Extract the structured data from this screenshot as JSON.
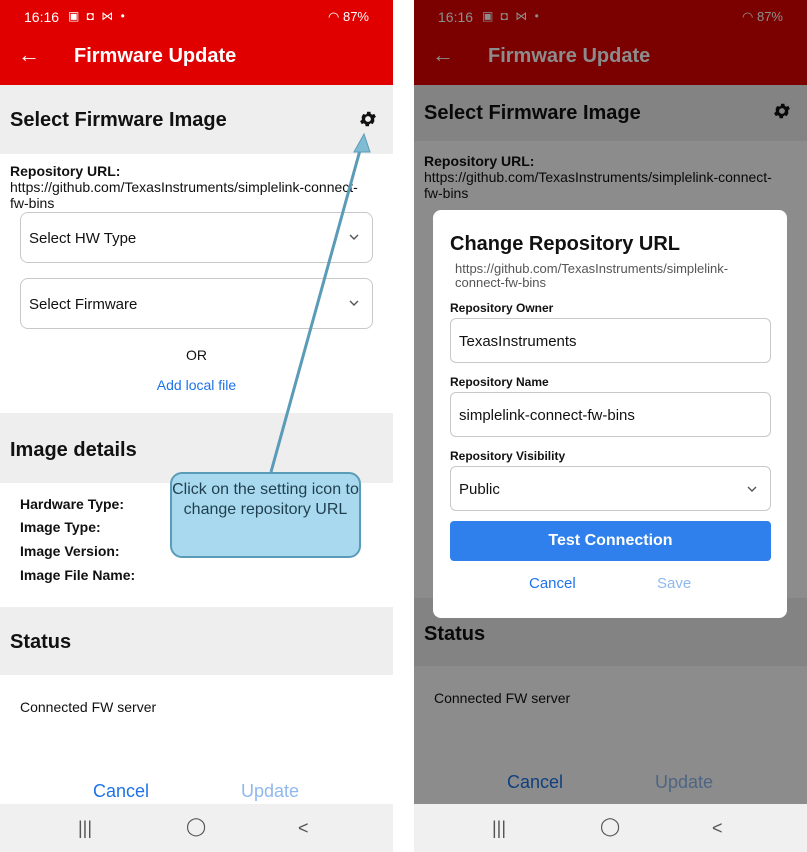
{
  "status_bar": {
    "time": "16:16",
    "notif_icons": "▣ ◘ ⋈ •",
    "signal": "87%"
  },
  "app_bar": {
    "title": "Firmware Update",
    "back_glyph": "←"
  },
  "select_section": {
    "title": "Select Firmware Image",
    "repo_label": "Repository URL:",
    "repo_url": "https://github.com/TexasInstruments/simplelink-connect-fw-bins",
    "hw_type_placeholder": "Select HW Type",
    "firmware_placeholder": "Select Firmware",
    "or_label": "OR",
    "add_local_file": "Add local file"
  },
  "image_details": {
    "title": "Image details",
    "fields": [
      "Hardware Type:",
      "Image Type:",
      "Image Version:",
      "Image File Name:"
    ]
  },
  "status": {
    "title": "Status",
    "message": "Connected FW server"
  },
  "actions": {
    "cancel": "Cancel",
    "update": "Update"
  },
  "callout": {
    "text": "Click on the setting icon to change repository URL"
  },
  "dialog": {
    "title": "Change Repository URL",
    "url_preview": "https://github.com/TexasInstruments/simplelink-connect-fw-bins",
    "owner_label": "Repository Owner",
    "owner_value": "TexasInstruments",
    "name_label": "Repository Name",
    "name_value": "simplelink-connect-fw-bins",
    "visibility_label": "Repository Visibility",
    "visibility_value": "Public",
    "test_button": "Test Connection",
    "cancel": "Cancel",
    "save": "Save"
  },
  "colors": {
    "accent": "#e00000",
    "link": "#1e73e8",
    "primary_button": "#2f80ed",
    "callout_fill": "#a9d9ee"
  }
}
